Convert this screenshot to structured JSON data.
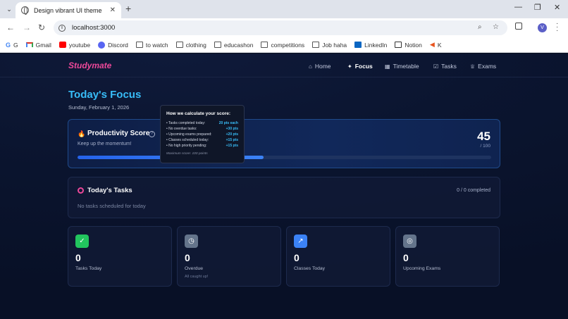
{
  "browser": {
    "tab_title": "Design vibrant UI theme",
    "url": "localhost:3000",
    "profile_initial": "V",
    "bookmarks": [
      {
        "label": "G",
        "icon": "google-icon"
      },
      {
        "label": "Gmail",
        "icon": "gmail-icon"
      },
      {
        "label": "youtube",
        "icon": "youtube-icon"
      },
      {
        "label": "Discord",
        "icon": "discord-icon"
      },
      {
        "label": "to watch",
        "icon": "folder-icon"
      },
      {
        "label": "clothing",
        "icon": "folder-icon"
      },
      {
        "label": "educashon",
        "icon": "folder-icon"
      },
      {
        "label": "competitions",
        "icon": "folder-icon"
      },
      {
        "label": "Job haha",
        "icon": "folder-icon"
      },
      {
        "label": "LinkedIn",
        "icon": "linkedin-icon"
      },
      {
        "label": "Notion",
        "icon": "notion-icon"
      },
      {
        "label": "K",
        "icon": "k-icon"
      }
    ]
  },
  "app": {
    "brand": "Studymate",
    "nav": [
      {
        "label": "Home",
        "icon": "home-icon",
        "active": false
      },
      {
        "label": "Focus",
        "icon": "sparkle-icon",
        "active": true
      },
      {
        "label": "Timetable",
        "icon": "calendar-icon",
        "active": false
      },
      {
        "label": "Tasks",
        "icon": "checkbox-icon",
        "active": false
      },
      {
        "label": "Exams",
        "icon": "trophy-icon",
        "active": false
      }
    ],
    "page_title": "Today's Focus",
    "page_date": "Sunday, February 1, 2026",
    "score": {
      "title": "Productivity Score",
      "subtitle": "Keep up the momentum!",
      "value": "45",
      "max": "/ 100",
      "progress": 0.45
    },
    "tooltip": {
      "title": "How we calculate your score:",
      "rows": [
        {
          "label": "• Tasks completed today:",
          "pts": "20 pts each"
        },
        {
          "label": "• No overdue tasks:",
          "pts": "+30 pts"
        },
        {
          "label": "• Upcoming exams prepared:",
          "pts": "+20 pts"
        },
        {
          "label": "• Classes scheduled today:",
          "pts": "+15 pts"
        },
        {
          "label": "• No high priority pending:",
          "pts": "+15 pts"
        }
      ],
      "footer": "Maximum score: 100 points"
    },
    "tasks": {
      "title": "Today's Tasks",
      "count": "0 / 0 completed",
      "empty": "No tasks scheduled for today"
    },
    "stats": [
      {
        "value": "0",
        "label": "Tasks Today",
        "sub": "",
        "icon": "check-circle-icon",
        "color": "#22c55e"
      },
      {
        "value": "0",
        "label": "Overdue",
        "sub": "All caught up!",
        "icon": "clock-icon",
        "color": "#64748b"
      },
      {
        "value": "0",
        "label": "Classes Today",
        "sub": "",
        "icon": "trending-up-icon",
        "color": "#3b82f6"
      },
      {
        "value": "0",
        "label": "Upcoming Exams",
        "sub": "",
        "icon": "target-icon",
        "color": "#64748b"
      }
    ]
  }
}
